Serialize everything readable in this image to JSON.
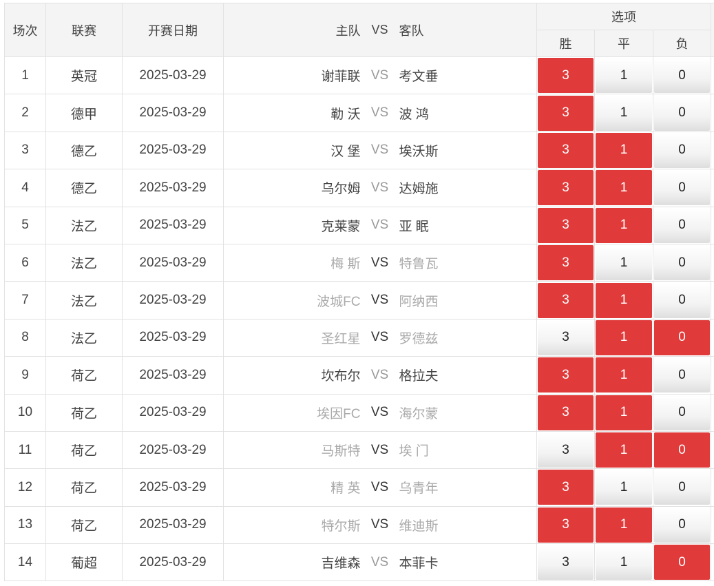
{
  "header": {
    "col_num": "场次",
    "col_league": "联赛",
    "col_date": "开赛日期",
    "col_home": "主队",
    "col_vs": "VS",
    "col_away": "客队",
    "col_options": "选项",
    "opt_win": "胜",
    "opt_draw": "平",
    "opt_lose": "负"
  },
  "accent_color": "#e03a3a",
  "rows": [
    {
      "num": "1",
      "league": "英冠",
      "date": "2025-03-29",
      "home": "谢菲联",
      "away": "考文垂",
      "win": "3",
      "draw": "1",
      "lose": "0",
      "sel": [
        true,
        false,
        false
      ],
      "dim": [
        false,
        false
      ],
      "vs_dark": false
    },
    {
      "num": "2",
      "league": "德甲",
      "date": "2025-03-29",
      "home": "勒 沃",
      "away": "波 鸿",
      "win": "3",
      "draw": "1",
      "lose": "0",
      "sel": [
        true,
        false,
        false
      ],
      "dim": [
        false,
        false
      ],
      "vs_dark": false
    },
    {
      "num": "3",
      "league": "德乙",
      "date": "2025-03-29",
      "home": "汉 堡",
      "away": "埃沃斯",
      "win": "3",
      "draw": "1",
      "lose": "0",
      "sel": [
        true,
        true,
        false
      ],
      "dim": [
        false,
        false
      ],
      "vs_dark": false
    },
    {
      "num": "4",
      "league": "德乙",
      "date": "2025-03-29",
      "home": "乌尔姆",
      "away": "达姆施",
      "win": "3",
      "draw": "1",
      "lose": "0",
      "sel": [
        true,
        true,
        false
      ],
      "dim": [
        false,
        false
      ],
      "vs_dark": false
    },
    {
      "num": "5",
      "league": "法乙",
      "date": "2025-03-29",
      "home": "克莱蒙",
      "away": "亚 眠",
      "win": "3",
      "draw": "1",
      "lose": "0",
      "sel": [
        true,
        true,
        false
      ],
      "dim": [
        false,
        false
      ],
      "vs_dark": false
    },
    {
      "num": "6",
      "league": "法乙",
      "date": "2025-03-29",
      "home": "梅 斯",
      "away": "特鲁瓦",
      "win": "3",
      "draw": "1",
      "lose": "0",
      "sel": [
        true,
        false,
        false
      ],
      "dim": [
        true,
        true
      ],
      "vs_dark": true
    },
    {
      "num": "7",
      "league": "法乙",
      "date": "2025-03-29",
      "home": "波城FC",
      "away": "阿纳西",
      "win": "3",
      "draw": "1",
      "lose": "0",
      "sel": [
        true,
        true,
        false
      ],
      "dim": [
        true,
        true
      ],
      "vs_dark": true
    },
    {
      "num": "8",
      "league": "法乙",
      "date": "2025-03-29",
      "home": "圣红星",
      "away": "罗德兹",
      "win": "3",
      "draw": "1",
      "lose": "0",
      "sel": [
        false,
        true,
        true
      ],
      "dim": [
        true,
        true
      ],
      "vs_dark": true
    },
    {
      "num": "9",
      "league": "荷乙",
      "date": "2025-03-29",
      "home": "坎布尔",
      "away": "格拉夫",
      "win": "3",
      "draw": "1",
      "lose": "0",
      "sel": [
        true,
        true,
        false
      ],
      "dim": [
        false,
        false
      ],
      "vs_dark": false
    },
    {
      "num": "10",
      "league": "荷乙",
      "date": "2025-03-29",
      "home": "埃因FC",
      "away": "海尔蒙",
      "win": "3",
      "draw": "1",
      "lose": "0",
      "sel": [
        true,
        true,
        false
      ],
      "dim": [
        true,
        true
      ],
      "vs_dark": true
    },
    {
      "num": "11",
      "league": "荷乙",
      "date": "2025-03-29",
      "home": "马斯特",
      "away": "埃 门",
      "win": "3",
      "draw": "1",
      "lose": "0",
      "sel": [
        false,
        true,
        true
      ],
      "dim": [
        true,
        true
      ],
      "vs_dark": true
    },
    {
      "num": "12",
      "league": "荷乙",
      "date": "2025-03-29",
      "home": "精 英",
      "away": "乌青年",
      "win": "3",
      "draw": "1",
      "lose": "0",
      "sel": [
        true,
        false,
        false
      ],
      "dim": [
        true,
        true
      ],
      "vs_dark": true
    },
    {
      "num": "13",
      "league": "荷乙",
      "date": "2025-03-29",
      "home": "特尔斯",
      "away": "维迪斯",
      "win": "3",
      "draw": "1",
      "lose": "0",
      "sel": [
        true,
        true,
        false
      ],
      "dim": [
        true,
        true
      ],
      "vs_dark": true
    },
    {
      "num": "14",
      "league": "葡超",
      "date": "2025-03-29",
      "home": "吉维森",
      "away": "本菲卡",
      "win": "3",
      "draw": "1",
      "lose": "0",
      "sel": [
        false,
        false,
        true
      ],
      "dim": [
        false,
        false
      ],
      "vs_dark": false
    }
  ]
}
